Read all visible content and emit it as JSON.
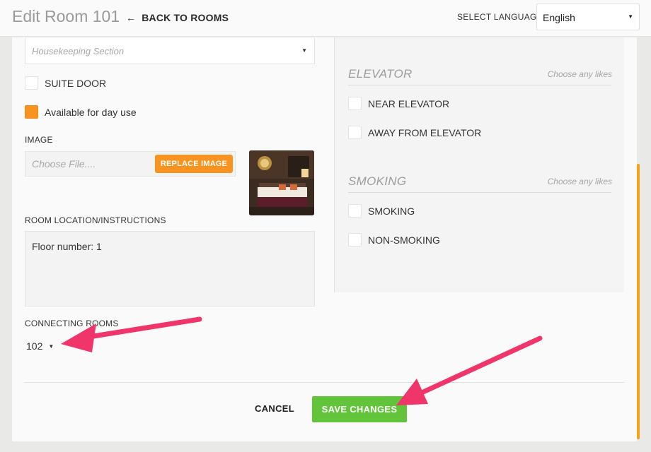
{
  "header": {
    "title": "Edit Room 101",
    "back_label": "BACK TO ROOMS",
    "language_label": "SELECT LANGUAGE",
    "language_value": "English"
  },
  "form": {
    "section_select_placeholder": "Housekeeping Section",
    "suite_door_label": "SUITE DOOR",
    "day_use_label": "Available for day use",
    "image_label": "IMAGE",
    "file_placeholder": "Choose File....",
    "replace_image_label": "REPLACE IMAGE",
    "location_label": "ROOM LOCATION/INSTRUCTIONS",
    "location_value": "Floor number: 1",
    "connecting_label": "CONNECTING ROOMS",
    "connecting_value": "102"
  },
  "preferences": {
    "elevator": {
      "title": "ELEVATOR",
      "hint": "Choose any likes",
      "options": [
        "NEAR ELEVATOR",
        "AWAY FROM ELEVATOR"
      ]
    },
    "smoking": {
      "title": "SMOKING",
      "hint": "Choose any likes",
      "options": [
        "SMOKING",
        "NON-SMOKING"
      ]
    }
  },
  "footer": {
    "cancel_label": "CANCEL",
    "save_label": "SAVE CHANGES"
  },
  "colors": {
    "accent_orange": "#f7931e",
    "save_green": "#62c43a",
    "annotation_arrow": "#f0356b"
  }
}
